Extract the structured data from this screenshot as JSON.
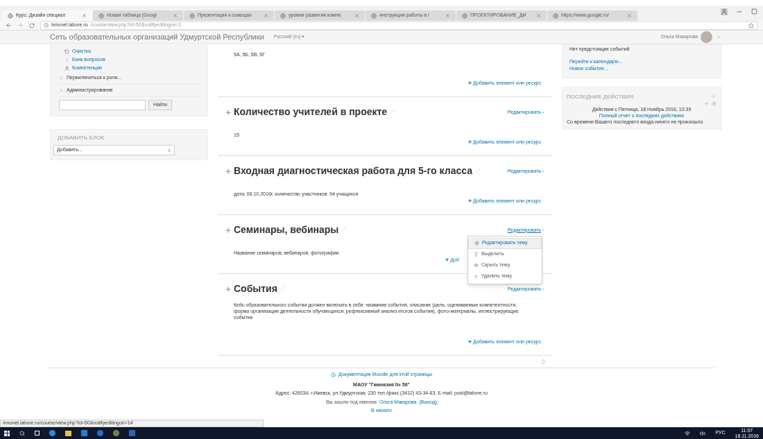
{
  "browser": {
    "tabs": [
      {
        "title": "Курс: Дизайн специал",
        "selected": true
      },
      {
        "title": "Новая таблица (Googl",
        "selected": false
      },
      {
        "title": "Презентация к совещан",
        "selected": false
      },
      {
        "title": "уровни развития компе",
        "selected": false
      },
      {
        "title": "инструкция работы в l",
        "selected": false
      },
      {
        "title": "ПРОЕКТИРОВАНИЕ_ДИ",
        "selected": false
      },
      {
        "title": "https://www.google.ru/",
        "selected": false
      }
    ],
    "address": {
      "host": "innonet.labore.ru",
      "path": "/course/view.php?id=50&notifyeditingon=1"
    }
  },
  "navbar": {
    "site_name": "Сеть образовательных организаций Удмуртской Республики",
    "language": "Русский (ru) ▾",
    "user_name": "Ольга Макарова"
  },
  "left": {
    "admin_items": [
      {
        "label": "Очистка",
        "kind": "reset"
      },
      {
        "label": "Банк вопросов",
        "kind": "branch"
      },
      {
        "label": "Компетенции",
        "kind": "person"
      }
    ],
    "nav_items": [
      {
        "label": "Переключиться к роли..."
      },
      {
        "label": "Администрирование"
      }
    ],
    "search_button": "Найти",
    "add_block": {
      "title": "ДОБАВИТЬ БЛОК",
      "select_value": "Добавить..."
    }
  },
  "sections": [
    {
      "summary": "5А, 5Б, 5В, 5Г",
      "add_link": "Добавить элемент или ресурс"
    },
    {
      "title": "Количество учителей в проекте",
      "summary": "15",
      "add_link": "Добавить элемент или ресурс",
      "edit": {
        "label": "Редактировать",
        "expanded": false
      }
    },
    {
      "title": "Входная диагностическая работа для 5-го класса",
      "summary": "дата: 06.10.2016г, количество участников: 94 учащихся",
      "add_link": "Добавить элемент или ресурс",
      "edit": {
        "label": "Редактировать",
        "expanded": false
      }
    },
    {
      "title": "Семинары, вебинары",
      "summary": "Название семинаров, вебинаров, фотографии",
      "add_link": "Доб",
      "edit": {
        "label": "Редактировать",
        "expanded": true,
        "menu": [
          {
            "label": "Редактировать тему",
            "kind": "gear",
            "selected": true
          },
          {
            "label": "Выделить",
            "kind": "highlight",
            "selected": false
          },
          {
            "label": "Скрыть тему",
            "kind": "eye",
            "selected": false
          },
          {
            "label": "Удалить тему",
            "kind": "delete",
            "selected": false
          }
        ]
      }
    },
    {
      "title": "События",
      "summary": "Кейс образовательного события должен включать в себя: название события, описание (цель, оцениваемые компетентности, форма организации деятельности обучающихся, рефлексивный анализ итогов события), фото-материалы, иллюстрирующие событие",
      "add_link": "Добавить элемент или ресурс",
      "edit": {
        "label": "Редактировать",
        "expanded": false
      }
    }
  ],
  "right": {
    "calendar": {
      "text": "Нет предстоящих событий",
      "links": [
        "Перейти к календарю...",
        "Новое событие..."
      ]
    },
    "recent": {
      "title": "ПОСЛЕДНИЕ ДЕЙСТВИЯ",
      "since": "Действия с Пятница, 18 Ноябрь 2016, 10:39",
      "report_link": "Полный отчет о последних действиях",
      "note": "Со времени Вашего последнего входа ничего не произошло"
    }
  },
  "footer": {
    "docs_link": "Документация Moodle для этой страницы",
    "org": "МАОУ \"Гимназия № 56\"",
    "address": "Адрес: 426034, г.Ижевск, ул.Удмуртская, 230 тел./факс (3412) 43-34-63. E-mail: post@labore.ru",
    "login_prefix": "Вы зашли под именем",
    "login_user": "Ольга Макарова",
    "logout": "(Выход)",
    "home_link": "В начало"
  },
  "status_url": "innonet.labore.ru/course/view.php?id=50&notifyeditingon=1#",
  "taskbar": {
    "language": "РУС",
    "time": "11:07",
    "date": "18.11.2016"
  }
}
